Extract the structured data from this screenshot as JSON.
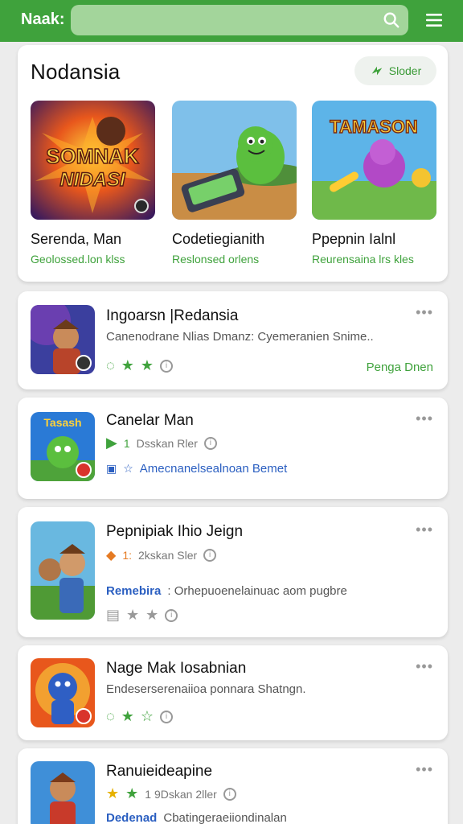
{
  "header": {
    "brand": "Naak:",
    "search_placeholder": ""
  },
  "featured": {
    "title": "Nodansia",
    "slider_label": "Sloder",
    "items": [
      {
        "name": "Serenda, Man",
        "subtitle": "Geolossed.lon klss",
        "art_text": "SOMNAK NIDASI"
      },
      {
        "name": "Codetiegianith",
        "subtitle": "Reslonsed orlens"
      },
      {
        "name": "Ppepnin Ialnl",
        "subtitle": "Reurensaina lrs kles",
        "art_text": "TAMASON"
      }
    ]
  },
  "cards": [
    {
      "title": "Ingoarsn |Redansia",
      "desc": "Canenodrane Nlias Dmanz: Cyemeranien Snime..",
      "right_link": "Penga Dnen",
      "more": "•••"
    },
    {
      "title": "Canelar Man",
      "meta": "Dsskan Rler",
      "meta_num": "1",
      "link_text": "Amecnanelsealnoan Bemet",
      "more": "•••"
    },
    {
      "title": "Pepnipiak Ihio Jeign",
      "meta": "2kskan Sler",
      "meta_num": "1:",
      "link_label": "Remebira",
      "link_text": ": Orhepuoenelainuac aom pugbre",
      "more": "•••"
    },
    {
      "title": "Nage Mak Iosabnian",
      "desc": "Endeserserenaiioa ponnara Shatngn.",
      "more": "•••"
    },
    {
      "title": "Ranuieideapine",
      "meta": "1 9Dskan 2ller",
      "link_label": "Dedenad",
      "link_text": "Cbatingeraeiiondinalan",
      "more": "•••"
    }
  ],
  "colors": {
    "brand_green": "#3fa23c",
    "link_blue": "#2b5fc1"
  }
}
